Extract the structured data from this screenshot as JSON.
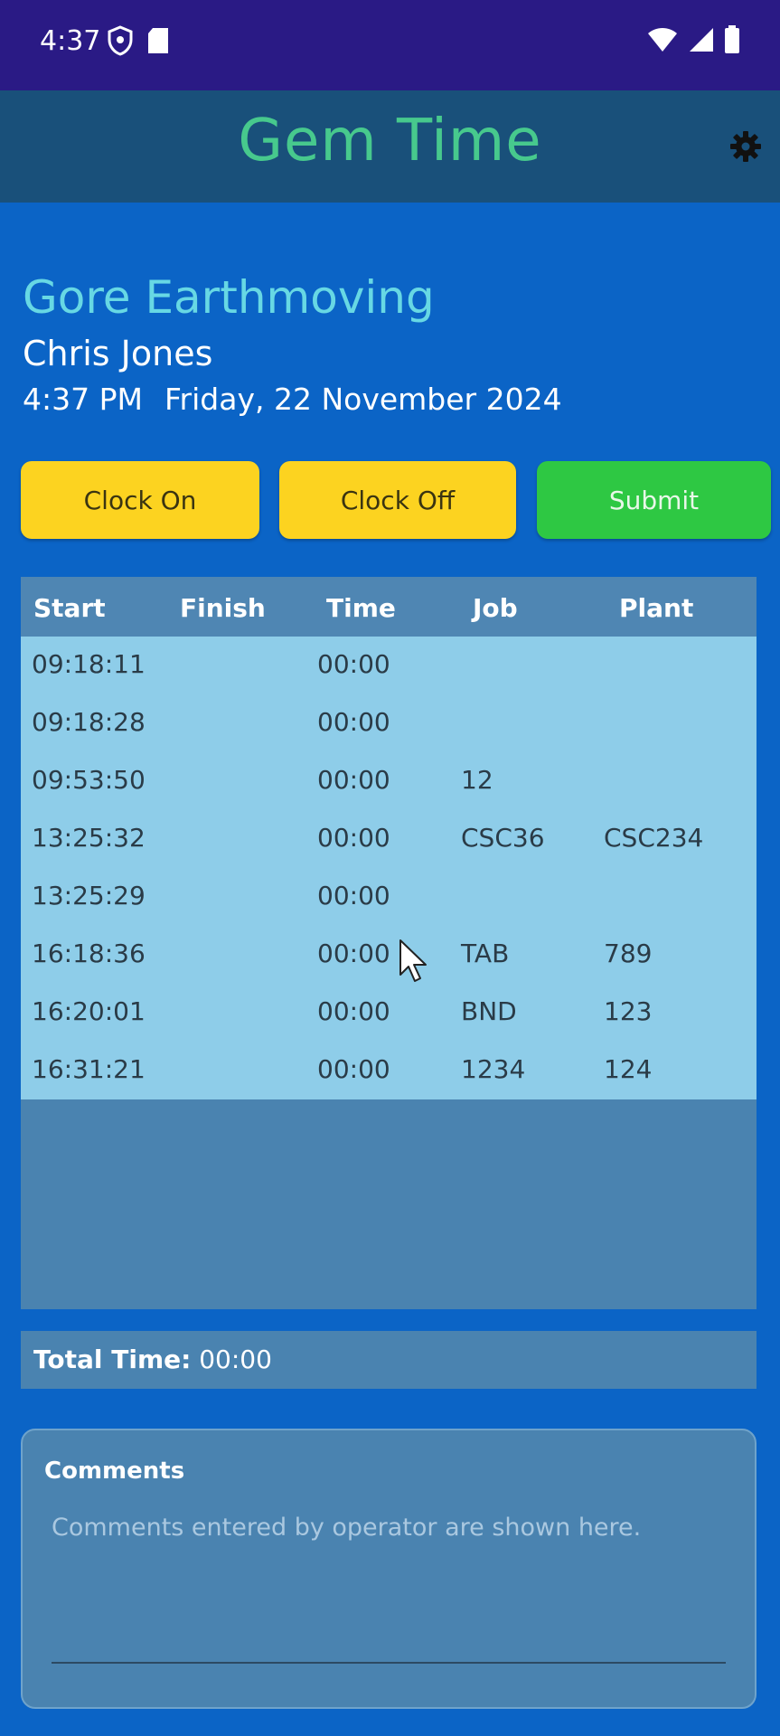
{
  "status_bar": {
    "time": "4:37",
    "left_icons": [
      "shield-icon",
      "sd-card-icon"
    ],
    "right_icons": [
      "wifi-icon",
      "signal-icon",
      "battery-icon"
    ]
  },
  "header": {
    "title": "Gem Time",
    "settings_icon": "gear-icon"
  },
  "info": {
    "company": "Gore Earthmoving",
    "user": "Chris Jones",
    "time": "4:37 PM",
    "date": "Friday, 22 November 2024"
  },
  "buttons": {
    "clock_on": "Clock On",
    "clock_off": "Clock Off",
    "submit": "Submit"
  },
  "table": {
    "columns": [
      "Start",
      "Finish",
      "Time",
      "Job",
      "Plant"
    ],
    "rows": [
      {
        "start": "09:18:11",
        "finish": "",
        "time": "00:00",
        "job": "",
        "plant": ""
      },
      {
        "start": "09:18:28",
        "finish": "",
        "time": "00:00",
        "job": "",
        "plant": ""
      },
      {
        "start": "09:53:50",
        "finish": "",
        "time": "00:00",
        "job": "12",
        "plant": ""
      },
      {
        "start": "13:25:32",
        "finish": "",
        "time": "00:00",
        "job": "CSC36",
        "plant": "CSC234"
      },
      {
        "start": "13:25:29",
        "finish": "",
        "time": "00:00",
        "job": "",
        "plant": ""
      },
      {
        "start": "16:18:36",
        "finish": "",
        "time": "00:00",
        "job": "TAB",
        "plant": "789"
      },
      {
        "start": "16:20:01",
        "finish": "",
        "time": "00:00",
        "job": "BND",
        "plant": "123"
      },
      {
        "start": "16:31:21",
        "finish": "",
        "time": "00:00",
        "job": "1234",
        "plant": "124"
      }
    ]
  },
  "total": {
    "label": "Total Time:",
    "value": "00:00"
  },
  "comments": {
    "label": "Comments",
    "placeholder": "Comments entered by operator are shown here.",
    "value": ""
  },
  "colors": {
    "background": "#0b64c6",
    "status_bar": "#2a1a85",
    "header": "#19507a",
    "title": "#47c98d",
    "company": "#67d8e4",
    "button_yellow": "#fcd320",
    "button_green": "#2ec843",
    "table_rows": "#8ecde9",
    "panel": "#4a83b0"
  }
}
